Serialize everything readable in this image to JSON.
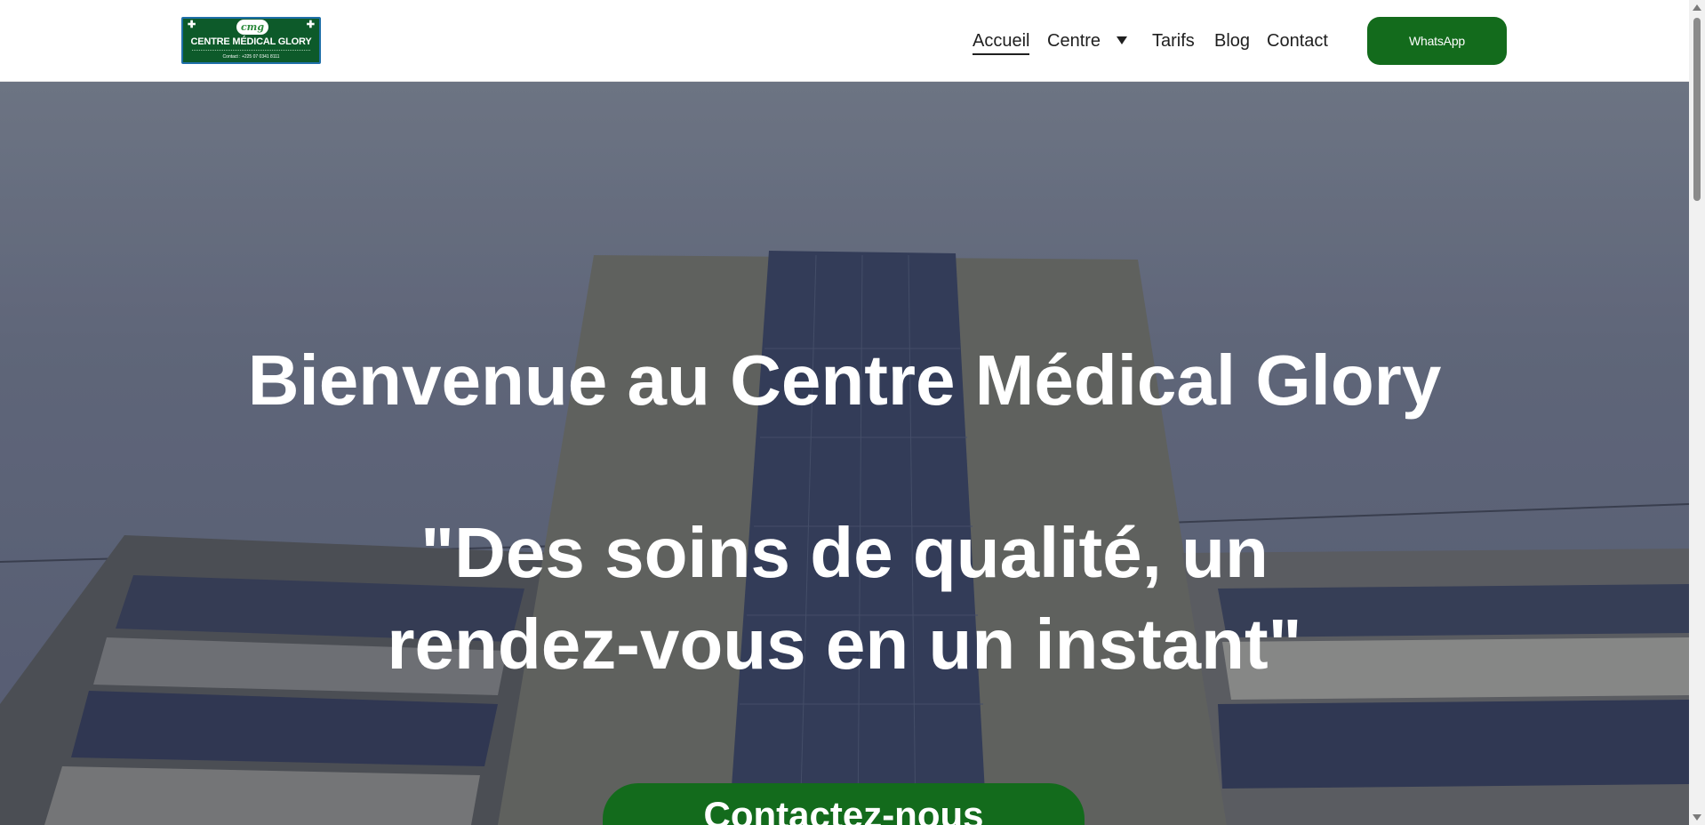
{
  "logo": {
    "emblem": "cmg",
    "name": "CENTRE MÉDICAL GLORY",
    "contact": "Contact : +225 07 0341 8111",
    "icons": [
      "medical-cross-icon",
      "medical-cross-icon"
    ]
  },
  "nav": {
    "items": [
      {
        "label": "Accueil",
        "active": true
      },
      {
        "label": "Centre",
        "has_dropdown": true
      },
      {
        "label": "Tarifs"
      },
      {
        "label": "Blog"
      },
      {
        "label": "Contact"
      }
    ],
    "dropdown_icon": "caret-down-icon",
    "whatsapp_label": "WhatsApp"
  },
  "hero": {
    "title": "Bienvenue au Centre Médical Glory",
    "quote": "\"Des soins de qualité, un rendez-vous en un instant\"",
    "cta_label": "Contactez-nous",
    "background": "hospital-building-photo"
  },
  "colors": {
    "brand_green": "#136b1c",
    "logo_green": "#0d5a2a",
    "text_dark": "#1f1f1f",
    "hero_text": "#ffffff"
  }
}
